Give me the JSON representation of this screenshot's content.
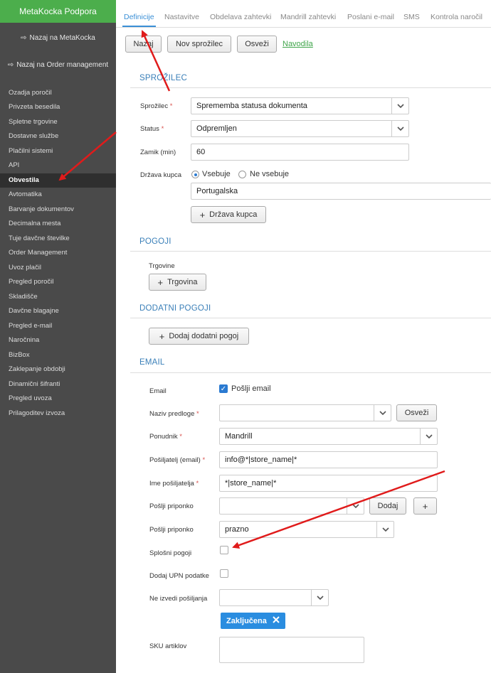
{
  "sidebar": {
    "brand": "MetaKocka Podpora",
    "back_links": [
      "Nazaj na MetaKocka",
      "Nazaj na Order management"
    ],
    "items": [
      "Ozadja poročil",
      "Privzeta besedila",
      "Spletne trgovine",
      "Dostavne službe",
      "Plačilni sistemi",
      "API",
      "Obvestila",
      "Avtomatika",
      "Barvanje dokumentov",
      "Decimalna mesta",
      "Tuje davčne številke",
      "Order Management",
      "Uvoz plačil",
      "Pregled poročil",
      "Skladišče",
      "Davčne blagajne",
      "Pregled e-mail",
      "Naročnina",
      "BizBox",
      "Zaklepanje obdobji",
      "Dinamični šifranti",
      "Pregled uvoza",
      "Prilagoditev izvoza"
    ],
    "active_item": "Obvestila"
  },
  "tabs": [
    "Definicije",
    "Nastavitve",
    "Obdelava zahtevki",
    "Mandrill zahtevki",
    "Poslani e-mail",
    "SMS",
    "Kontrola naročil"
  ],
  "active_tab": "Definicije",
  "toolbar": {
    "back": "Nazaj",
    "new": "Nov sprožilec",
    "refresh": "Osveži",
    "help_link": "Navodila"
  },
  "sprozilec": {
    "title": "SPROŽILEC",
    "trigger_label": "Sprožilec",
    "trigger_value": "Sprememba statusa dokumenta",
    "status_label": "Status",
    "status_value": "Odpremljen",
    "delay_label": "Zamik (min)",
    "delay_value": "60",
    "country_label": "Država kupca",
    "radio_contains": "Vsebuje",
    "radio_not_contains": "Ne vsebuje",
    "country_value": "Portugalska",
    "add_country": "Država kupca"
  },
  "pogoji": {
    "title": "POGOJI",
    "stores_label": "Trgovine",
    "add_store": "Trgovina"
  },
  "dodatni": {
    "title": "DODATNI POGOJI",
    "add_condition": "Dodaj dodatni pogoj"
  },
  "email": {
    "title": "EMAIL",
    "email_label": "Email",
    "send_email": "Pošlji email",
    "template_label": "Naziv predloge",
    "template_refresh": "Osveži",
    "provider_label": "Ponudnik",
    "provider_value": "Mandrill",
    "sender_email_label": "Pošiljatelj (email)",
    "sender_email_value": "info@*|store_name|*",
    "sender_name_label": "Ime pošiljatelja",
    "sender_name_value": "*|store_name|*",
    "attach_label": "Pošlji priponko",
    "attach_add": "Dodaj",
    "attach2_label": "Pošlji priponko",
    "attach2_value": "prazno",
    "terms_label": "Splošni pogoji",
    "upn_label": "Dodaj UPN podatke",
    "skip_label": "Ne izvedi pošiljanja",
    "skip_tag": "Zaključena",
    "sku_label": "SKU artiklov"
  }
}
